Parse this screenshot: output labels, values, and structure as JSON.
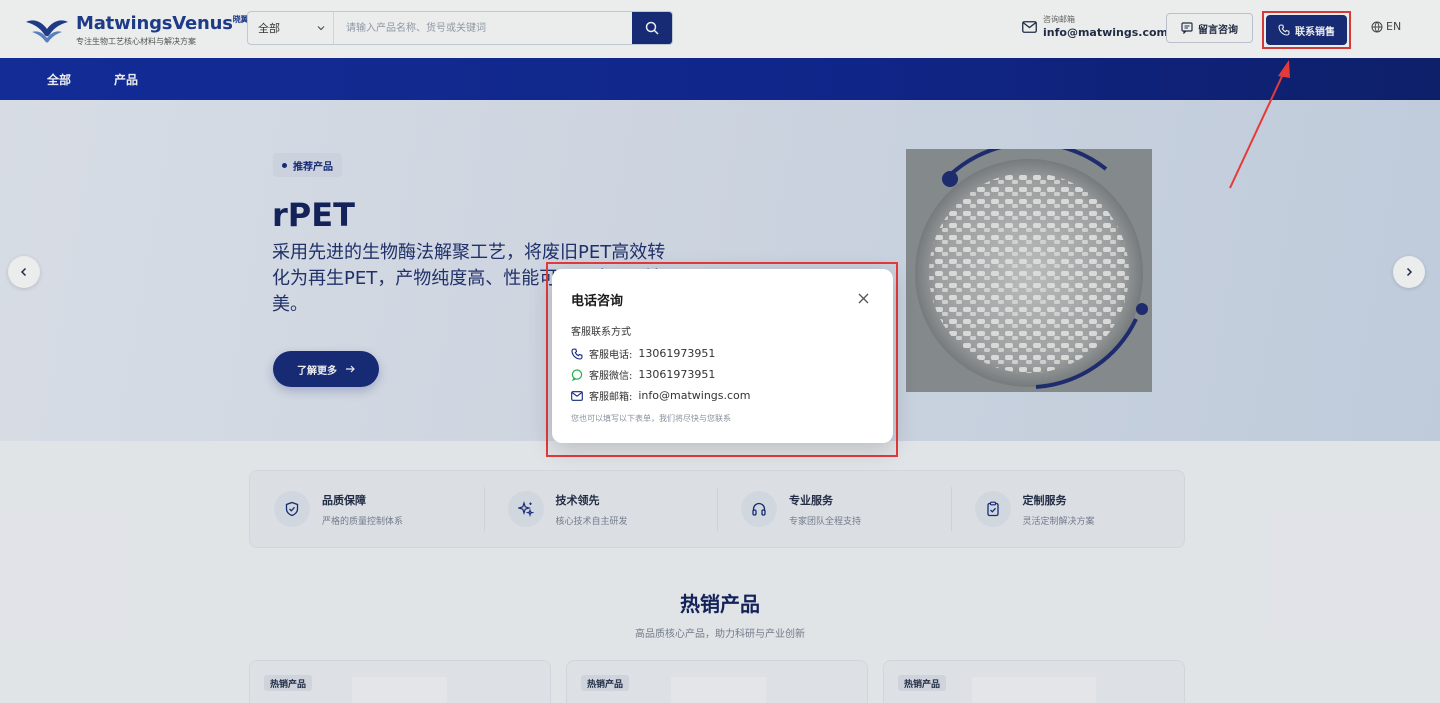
{
  "header": {
    "brand_name": "MatwingsVenus",
    "brand_mark": "晓翼™",
    "brand_tagline": "专注生物工艺核心材料与解决方案",
    "search": {
      "category": "全部",
      "placeholder": "请输入产品名称、货号或关键词"
    },
    "email_label": "咨询邮箱",
    "email_value": "info@matwings.com",
    "message_button": "留言咨询",
    "sales_button": "联系销售",
    "language": "EN"
  },
  "nav": {
    "items": [
      "全部",
      "产品"
    ]
  },
  "hero": {
    "badge": "推荐产品",
    "title": "rPET",
    "description": "采用先进的生物酶法解聚工艺，将废旧PET高效转化为再生PET，产物纯度高、性能可与原生PET媲美。",
    "button": "了解更多"
  },
  "features": [
    {
      "title": "品质保障",
      "subtitle": "严格的质量控制体系",
      "icon": "shield-check-icon"
    },
    {
      "title": "技术领先",
      "subtitle": "核心技术自主研发",
      "icon": "sparkles-icon"
    },
    {
      "title": "专业服务",
      "subtitle": "专家团队全程支持",
      "icon": "headphones-icon"
    },
    {
      "title": "定制服务",
      "subtitle": "灵活定制解决方案",
      "icon": "clipboard-check-icon"
    }
  ],
  "hot": {
    "title": "热销产品",
    "subtitle": "高品质核心产品，助力科研与产业创新",
    "cards": [
      {
        "tag": "热销产品"
      },
      {
        "tag": "热销产品"
      },
      {
        "tag": "热销产品"
      }
    ]
  },
  "modal": {
    "title": "电话咨询",
    "subtitle": "客服联系方式",
    "phone_label": "客服电话:",
    "phone_value": "13061973951",
    "wechat_label": "客服微信:",
    "wechat_value": "13061973951",
    "email_label": "客服邮箱:",
    "email_value": "info@matwings.com",
    "note": "您也可以填写以下表单，我们将尽快与您联系"
  },
  "colors": {
    "brand_navy": "#13287a",
    "annotation_red": "#e53a3a",
    "wechat_green": "#22b04b"
  }
}
